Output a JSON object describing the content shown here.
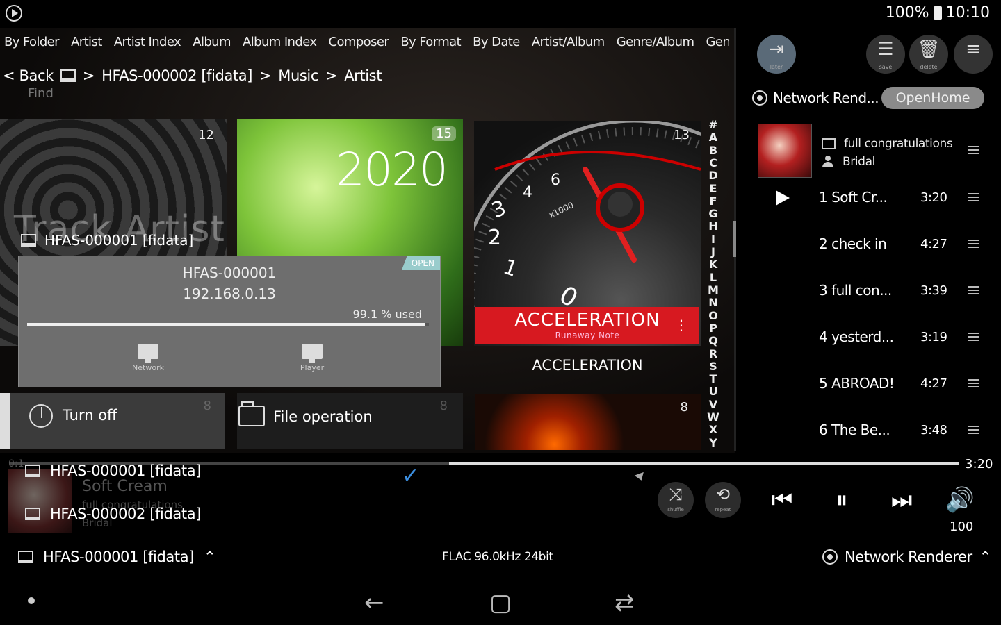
{
  "status_bar": {
    "battery": "100%",
    "time": "10:10"
  },
  "category_tabs": [
    "By Folder",
    "Artist",
    "Artist Index",
    "Album",
    "Album Index",
    "Composer",
    "By Format",
    "By Date",
    "Artist/Album",
    "Genre/Album",
    "Genre/A"
  ],
  "breadcrumb": {
    "back": "< Back",
    "sep1": ">",
    "server": "HFAS-000002 [fidata]",
    "sep2": ">",
    "folder": "Music",
    "sep3": ">",
    "current": "Artist"
  },
  "search_ghost": "Find",
  "tiles": {
    "a": {
      "count": "12",
      "ghost_text": "Track Artist"
    },
    "b": {
      "count": "15",
      "year": "2020"
    },
    "c": {
      "count": "13",
      "banner_title": "ACCELERATION",
      "banner_sub": "Runaway Note",
      "menu": "⋮",
      "caption": "ACCELERATION"
    },
    "d": {
      "count": "8",
      "label": "Turn off"
    },
    "e": {
      "count": "8",
      "label": "File operation"
    },
    "f": {
      "count": "8"
    }
  },
  "alpha_index": [
    "#",
    "A",
    "B",
    "C",
    "D",
    "E",
    "F",
    "G",
    "H",
    "I",
    "J",
    "K",
    "L",
    "M",
    "N",
    "O",
    "P",
    "Q",
    "R",
    "S",
    "T",
    "U",
    "V",
    "W",
    "X",
    "Y"
  ],
  "device_popup": {
    "header": "HFAS-000001 [fidata]",
    "name": "HFAS-000001",
    "ip": "192.168.0.13",
    "badge": "OPEN",
    "usage_label": "99.1 % used",
    "usage_percent": 99.1,
    "network_label": "Network",
    "player_label": "Player"
  },
  "right_panel": {
    "toolbar": {
      "later": "later",
      "save": "save",
      "delete": "delete"
    },
    "renderer_name": "Network Rend...",
    "openhome": "OpenHome",
    "album": {
      "title": "full congratulations",
      "artist": "Bridal"
    },
    "tracks": [
      {
        "num": "1",
        "title": "Soft Cr...",
        "duration": "3:20"
      },
      {
        "num": "2",
        "title": "check in",
        "duration": "4:27"
      },
      {
        "num": "3",
        "title": "full con...",
        "duration": "3:39"
      },
      {
        "num": "4",
        "title": "yesterd...",
        "duration": "3:19"
      },
      {
        "num": "5",
        "title": "ABROAD!",
        "duration": "4:27"
      },
      {
        "num": "6",
        "title": "The Be...",
        "duration": "3:48"
      }
    ]
  },
  "seek": {
    "start": "0:1",
    "end": "3:20"
  },
  "now_playing_ghost": {
    "title": "Soft Cream",
    "album": "full congratulations",
    "artist": "Bridal"
  },
  "device_list": [
    "HFAS-000001 [fidata]",
    "HFAS-000002 [fidata]"
  ],
  "controls": {
    "shuffle": "shuffle",
    "repeat": "repeat",
    "volume": "100"
  },
  "bottom_row": {
    "device": "HFAS-000001 [fidata]",
    "format": "FLAC 96.0kHz 24bit",
    "renderer": "Network Renderer"
  }
}
